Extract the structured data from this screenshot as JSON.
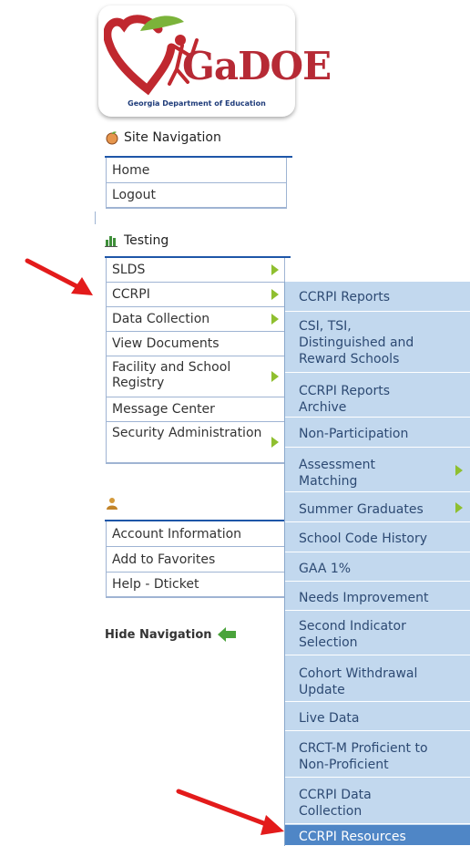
{
  "logo": {
    "brand": "GaDOE",
    "tagline": "Georgia Department of Education"
  },
  "site_navigation": {
    "heading": "Site Navigation",
    "items": [
      {
        "label": "Home"
      },
      {
        "label": "Logout"
      }
    ]
  },
  "testing": {
    "heading": "Testing",
    "items": [
      {
        "label": "SLDS",
        "has_submenu": true
      },
      {
        "label": "CCRPI",
        "has_submenu": true
      },
      {
        "label": "Data Collection",
        "has_submenu": true
      },
      {
        "label": "View Documents",
        "has_submenu": false
      },
      {
        "label": "Facility and School Registry",
        "has_submenu": true
      },
      {
        "label": "Message Center",
        "has_submenu": false
      },
      {
        "label": "Security Administration",
        "has_submenu": true
      }
    ]
  },
  "account": {
    "items": [
      {
        "label": "Account Information"
      },
      {
        "label": "Add to Favorites"
      },
      {
        "label": "Help - Dticket"
      }
    ]
  },
  "hide_navigation": {
    "label": "Hide Navigation"
  },
  "ccrpi_submenu": {
    "items": [
      {
        "label": "CCRPI Reports"
      },
      {
        "label": "CSI, TSI, Distinguished and Reward Schools"
      },
      {
        "label": "CCRPI Reports Archive"
      },
      {
        "label": "Non-Participation"
      },
      {
        "label": "Assessment Matching",
        "has_submenu": true
      },
      {
        "label": "Summer Graduates",
        "has_submenu": true
      },
      {
        "label": "School Code History"
      },
      {
        "label": "GAA 1%"
      },
      {
        "label": "Needs Improvement"
      },
      {
        "label": "Second Indicator Selection"
      },
      {
        "label": "Cohort Withdrawal Update"
      },
      {
        "label": "Live Data"
      },
      {
        "label": "CRCT-M Proficient to Non-Proficient"
      },
      {
        "label": "CCRPI Data Collection"
      },
      {
        "label": "CCRPI Resources",
        "active": true
      }
    ]
  },
  "colors": {
    "menu_border": "#9fb4d3",
    "heading_line": "#1e56a8",
    "submenu_bg": "#c2d8ee",
    "submenu_active": "#4f86c6",
    "submenu_arrow": "#8fbf2f",
    "annotation_arrow": "#e31b1b"
  }
}
